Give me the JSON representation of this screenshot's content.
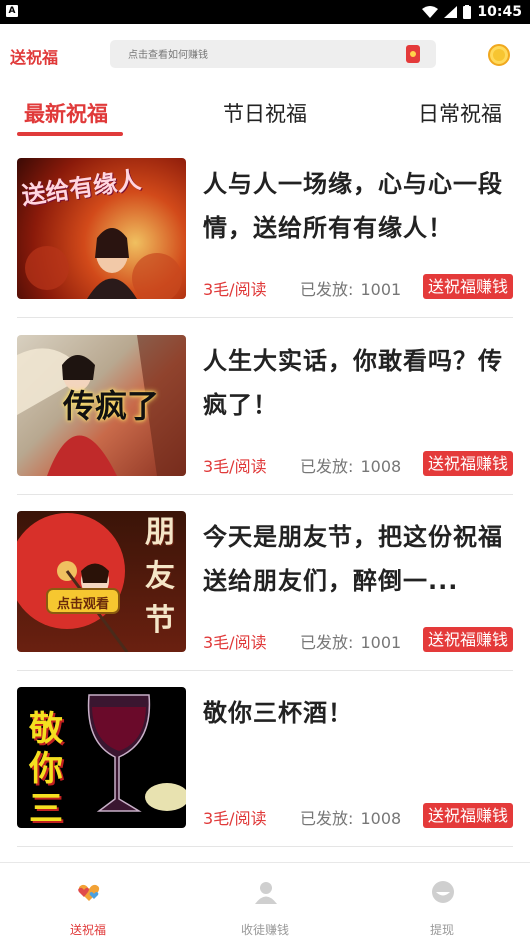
{
  "status_bar": {
    "time": "10:45",
    "left_badge": "A"
  },
  "header": {
    "brand": "送祝福",
    "search_placeholder": "点击查看如何赚钱"
  },
  "tabs": [
    {
      "label": "最新祝福",
      "active": true
    },
    {
      "label": "节日祝福",
      "active": false
    },
    {
      "label": "日常祝福",
      "active": false
    }
  ],
  "feed": [
    {
      "title": "人与人一场缘，心与心一段情，送给所有有缘人！",
      "thumb_text": "送给有缘人",
      "price": "3毛/阅读",
      "sent_label": "已发放:",
      "sent_count": "1001",
      "action": "送祝福赚钱"
    },
    {
      "title": "人生大实话，你敢看吗？传疯了！",
      "thumb_text": "传疯了",
      "price": "3毛/阅读",
      "sent_label": "已发放:",
      "sent_count": "1008",
      "action": "送祝福赚钱"
    },
    {
      "title": "今天是朋友节，把这份祝福送给朋友们，醉倒一...",
      "thumb_text": "朋友节",
      "thumb_badge": "点击观看",
      "price": "3毛/阅读",
      "sent_label": "已发放:",
      "sent_count": "1001",
      "action": "送祝福赚钱"
    },
    {
      "title": "敬你三杯酒！",
      "thumb_text": "敬你三杯",
      "price": "3毛/阅读",
      "sent_label": "已发放:",
      "sent_count": "1008",
      "action": "送祝福赚钱"
    }
  ],
  "bottom_nav": [
    {
      "label": "送祝福",
      "icon": "hearts-icon",
      "active": true
    },
    {
      "label": "收徒赚钱",
      "icon": "person-icon",
      "active": false
    },
    {
      "label": "提现",
      "icon": "wallet-icon",
      "active": false
    }
  ],
  "colors": {
    "accent": "#e03a3a",
    "button": "#e43a3a",
    "muted": "#777777"
  }
}
